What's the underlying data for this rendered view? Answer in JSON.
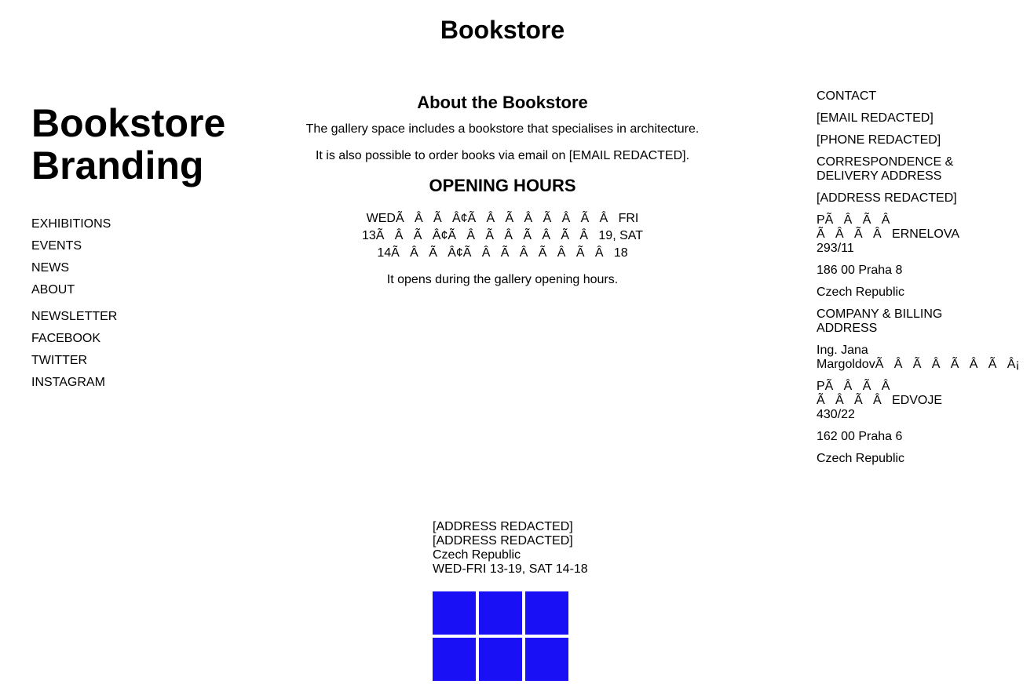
{
  "site_title": "Bookstore",
  "brand": [
    "Bookstore",
    "Branding"
  ],
  "nav": {
    "primary": [
      "EXHIBITIONS",
      "EVENTS",
      "NEWS",
      "ABOUT"
    ],
    "social": [
      "NEWSLETTER",
      "FACEBOOK",
      "TWITTER",
      "INSTAGRAM"
    ]
  },
  "main": {
    "title": "About the Bookstore",
    "p1": "The gallery space includes a bookstore that specialises in architecture.",
    "p2": "It is also possible to order books via email on [EMAIL REDACTED].",
    "hours_title": "OPENING HOURS",
    "hours_lines": [
      "WEDÃ   Â   Ã   Â¢Ã   Â   Ã   Â   Ã   Â   Ã   Â   FRI",
      "13Ã   Â   Ã   Â¢Ã   Â   Ã   Â   Ã   Â   Ã   Â   19, SAT",
      "14Ã   Â   Ã   Â¢Ã   Â   Ã   Â   Ã   Â   Ã   Â   18"
    ],
    "p3": "It opens during the gallery opening hours."
  },
  "contact": [
    "CONTACT",
    "[EMAIL REDACTED]",
    "[PHONE REDACTED]",
    "CORRESPONDENCE &\nDELIVERY ADDRESS",
    "[ADDRESS REDACTED]",
    "PÃ   Â   Ã   Â\nÃ   Â   Ã   Â   ERNELOVA\n293/11",
    "186 00 Praha 8",
    "Czech Republic",
    "COMPANY & BILLING\nADDRESS",
    "Ing. Jana\nMargoldovÃ   Â   Ã   Â   Ã   Â   Ã   Â¡",
    "PÃ   Â   Ã   Â\nÃ   Â   Ã   Â   EDVOJE\n430/22",
    "162 00 Praha 6",
    "Czech Republic"
  ],
  "footer": [
    "[ADDRESS REDACTED]",
    "[ADDRESS REDACTED]",
    "Czech Republic",
    "WED-FRI 13-19, SAT 14-18"
  ],
  "tile_color": "#1a10f5"
}
